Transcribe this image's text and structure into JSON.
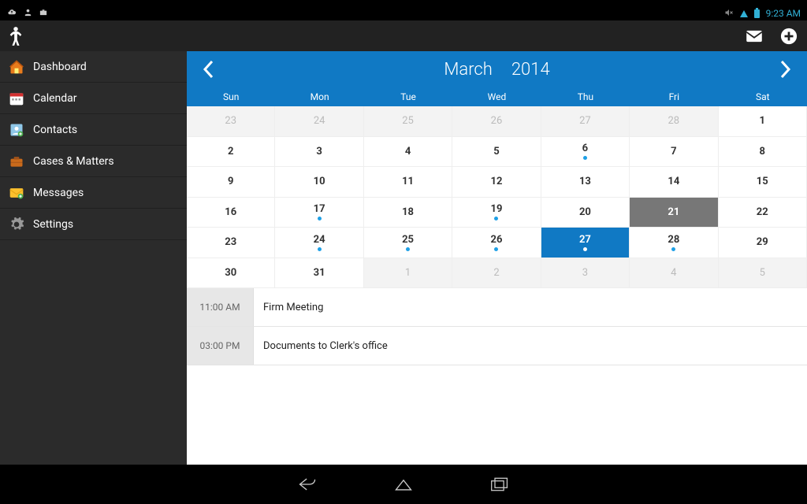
{
  "status": {
    "time": "9:23 AM"
  },
  "sidebar": {
    "items": [
      {
        "label": "Dashboard"
      },
      {
        "label": "Calendar"
      },
      {
        "label": "Contacts"
      },
      {
        "label": "Cases & Matters"
      },
      {
        "label": "Messages"
      },
      {
        "label": "Settings"
      }
    ]
  },
  "calendar": {
    "month": "March",
    "year": "2014",
    "weekdays": [
      "Sun",
      "Mon",
      "Tue",
      "Wed",
      "Thu",
      "Fri",
      "Sat"
    ],
    "weeks": [
      [
        {
          "n": "23",
          "other": true
        },
        {
          "n": "24",
          "other": true
        },
        {
          "n": "25",
          "other": true
        },
        {
          "n": "26",
          "other": true
        },
        {
          "n": "27",
          "other": true
        },
        {
          "n": "28",
          "other": true
        },
        {
          "n": "1"
        }
      ],
      [
        {
          "n": "2"
        },
        {
          "n": "3"
        },
        {
          "n": "4"
        },
        {
          "n": "5"
        },
        {
          "n": "6",
          "dot": true
        },
        {
          "n": "7"
        },
        {
          "n": "8"
        }
      ],
      [
        {
          "n": "9"
        },
        {
          "n": "10"
        },
        {
          "n": "11"
        },
        {
          "n": "12"
        },
        {
          "n": "13"
        },
        {
          "n": "14"
        },
        {
          "n": "15"
        }
      ],
      [
        {
          "n": "16"
        },
        {
          "n": "17",
          "dot": true
        },
        {
          "n": "18"
        },
        {
          "n": "19",
          "dot": true
        },
        {
          "n": "20"
        },
        {
          "n": "21",
          "highlight": true
        },
        {
          "n": "22"
        }
      ],
      [
        {
          "n": "23"
        },
        {
          "n": "24",
          "dot": true
        },
        {
          "n": "25",
          "dot": true
        },
        {
          "n": "26",
          "dot": true
        },
        {
          "n": "27",
          "dot": true,
          "selected": true
        },
        {
          "n": "28",
          "dot": true
        },
        {
          "n": "29"
        }
      ],
      [
        {
          "n": "30"
        },
        {
          "n": "31"
        },
        {
          "n": "1",
          "other": true
        },
        {
          "n": "2",
          "other": true
        },
        {
          "n": "3",
          "other": true
        },
        {
          "n": "4",
          "other": true
        },
        {
          "n": "5",
          "other": true
        }
      ]
    ]
  },
  "events": [
    {
      "time": "11:00 AM",
      "title": "Firm Meeting"
    },
    {
      "time": "03:00 PM",
      "title": "Documents to Clerk's office"
    }
  ]
}
